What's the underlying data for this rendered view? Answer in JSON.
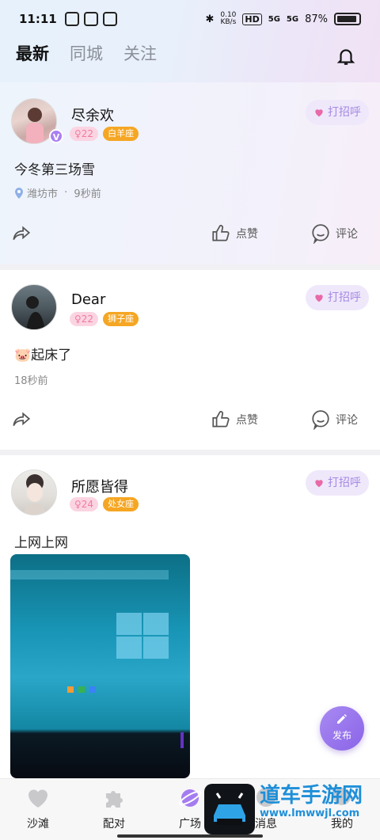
{
  "status_bar": {
    "time": "11:11",
    "net_speed_top": "0.10",
    "net_speed_bottom": "KB/s",
    "hd": "HD",
    "signal1": "5G",
    "signal2": "5G",
    "battery": "87%"
  },
  "tabs": [
    {
      "label": "最新",
      "active": true
    },
    {
      "label": "同城",
      "active": false
    },
    {
      "label": "关注",
      "active": false
    }
  ],
  "greet_label": "打招呼",
  "posts": [
    {
      "username": "尽余欢",
      "age": "22",
      "zodiac": "白羊座",
      "verified": true,
      "text": "今冬第三场雪",
      "location": "潍坊市",
      "time": "9秒前"
    },
    {
      "username": "Dear",
      "age": "22",
      "zodiac": "狮子座",
      "verified": false,
      "text": "🐷起床了",
      "time": "18秒前"
    },
    {
      "username": "所愿皆得",
      "age": "24",
      "zodiac": "处女座",
      "verified": false,
      "text": "上网上网"
    }
  ],
  "actions": {
    "like": "点赞",
    "comment": "评论"
  },
  "fab_label": "发布",
  "bottom_nav": [
    {
      "label": "沙滩",
      "icon": "heart-icon"
    },
    {
      "label": "配对",
      "icon": "puzzle-icon"
    },
    {
      "label": "广场",
      "icon": "planet-icon",
      "active": true
    },
    {
      "label": "消息",
      "icon": "chat-icon"
    },
    {
      "label": "我的",
      "icon": "profile-icon"
    }
  ],
  "watermark": {
    "text": "道车手游网",
    "url": "www.lmwwjl.com"
  },
  "colors": {
    "accent": "#a58ae3",
    "age_pink": "#f07aa0",
    "zodiac_orange": "#f5a623"
  }
}
